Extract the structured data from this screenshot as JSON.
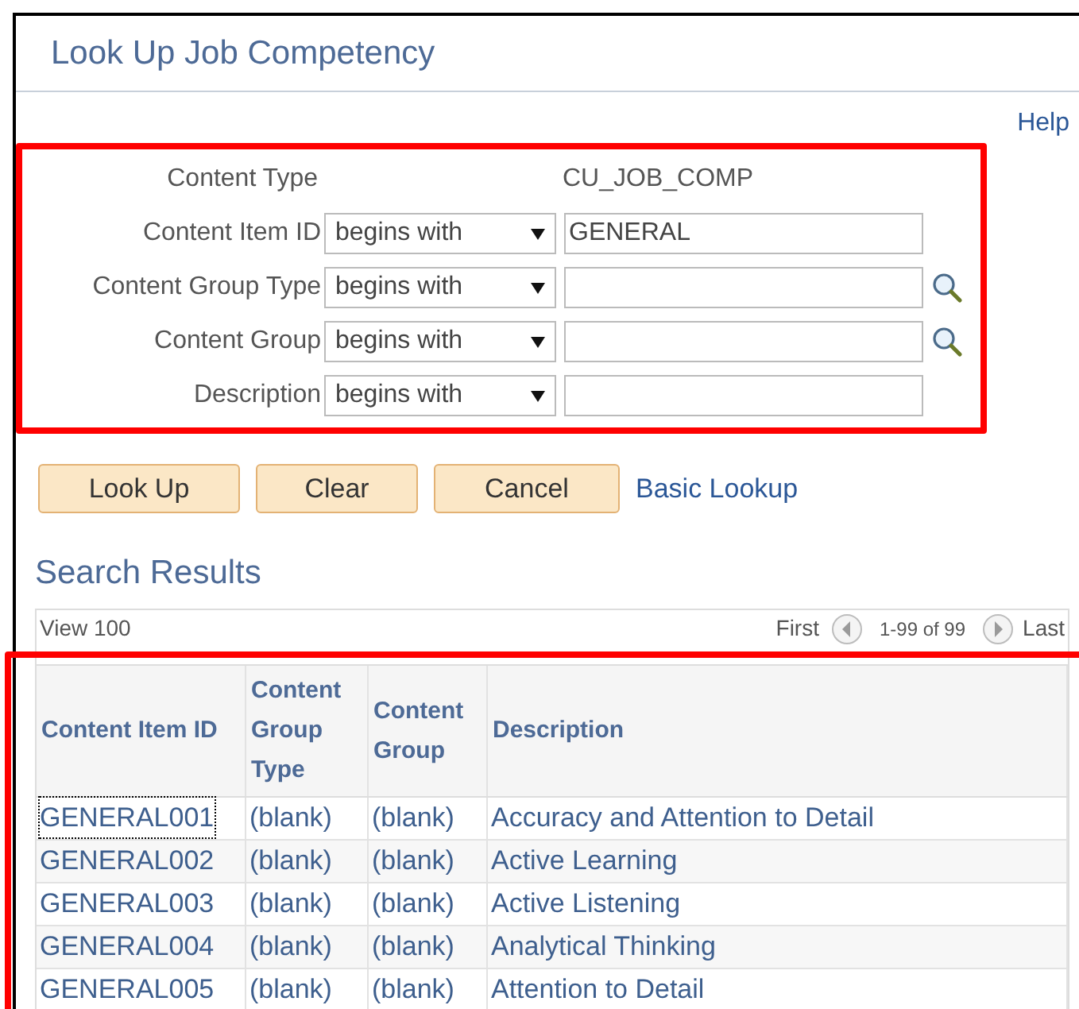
{
  "window": {
    "title": "Look Up Job Competency"
  },
  "help_link": "Help",
  "criteria": [
    {
      "kind": "static",
      "label": "Content Type",
      "value": "CU_JOB_COMP"
    },
    {
      "kind": "field",
      "label": "Content Item ID",
      "operator": "begins with",
      "value": "GENERAL",
      "lookup": false
    },
    {
      "kind": "field",
      "label": "Content Group Type",
      "operator": "begins with",
      "lookup": true
    },
    {
      "kind": "field",
      "label": "Content Group",
      "operator": "begins with",
      "lookup": true
    },
    {
      "kind": "field",
      "label": "Description",
      "operator": "begins with",
      "lookup": false
    }
  ],
  "buttons": [
    "Look Up",
    "Clear",
    "Cancel"
  ],
  "basic_lookup_link": "Basic Lookup",
  "results": {
    "title": "Search Results",
    "view_link": "View 100",
    "first_label": "First",
    "range": "1-99 of 99",
    "last_label": "Last",
    "columns": [
      "Content Item ID",
      "Content Group Type",
      "Content Group",
      "Description"
    ],
    "rows": [
      {
        "cells": [
          "GENERAL001",
          "(blank)",
          "(blank)",
          "Accuracy and Attention to Detail"
        ],
        "focused": true
      },
      {
        "cells": [
          "GENERAL002",
          "(blank)",
          "(blank)",
          "Active Learning"
        ],
        "focused": false
      },
      {
        "cells": [
          "GENERAL003",
          "(blank)",
          "(blank)",
          "Active Listening"
        ],
        "focused": false
      },
      {
        "cells": [
          "GENERAL004",
          "(blank)",
          "(blank)",
          "Analytical Thinking"
        ],
        "focused": false
      },
      {
        "cells": [
          "GENERAL005",
          "(blank)",
          "(blank)",
          "Attention to Detail"
        ],
        "focused": false
      }
    ]
  }
}
